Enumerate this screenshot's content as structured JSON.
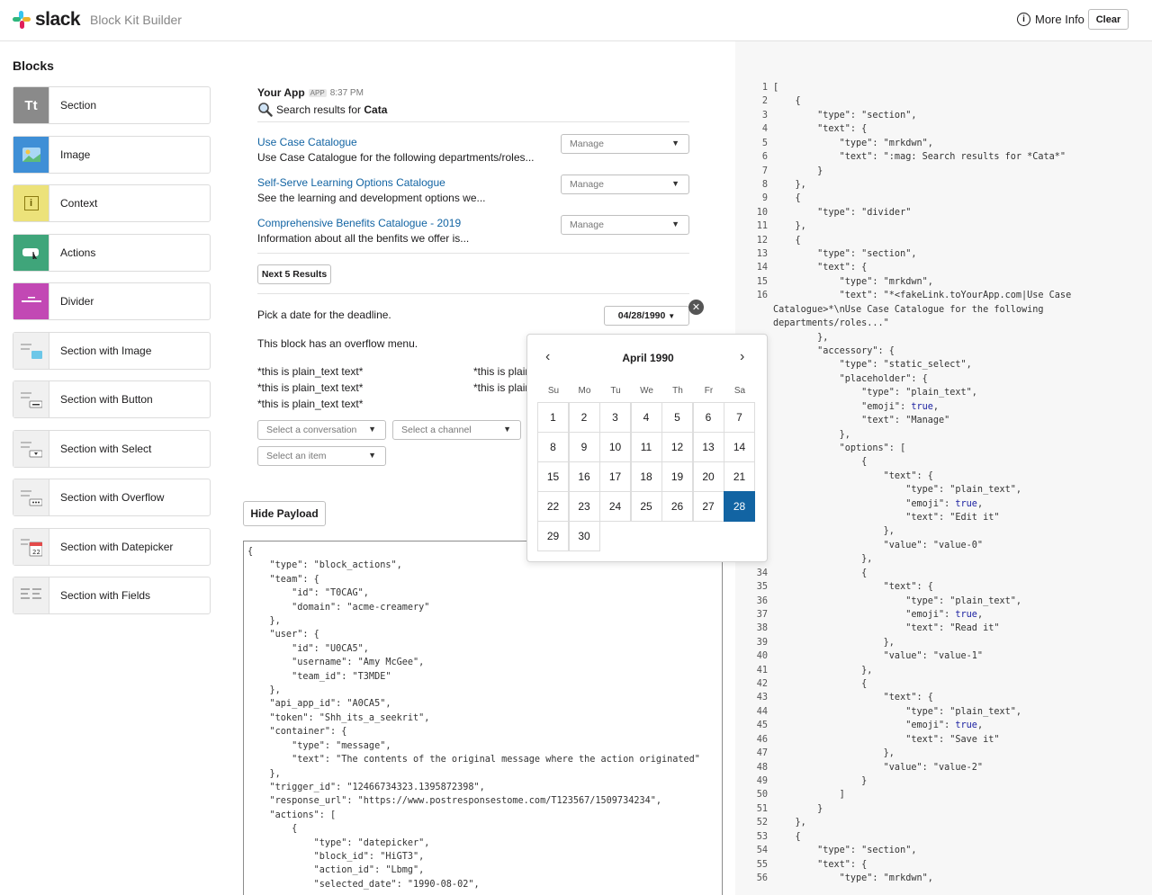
{
  "header": {
    "logo_text": "slack",
    "app_name": "Block Kit Builder",
    "more_info_label": "More Info",
    "clear_label": "Clear"
  },
  "sidebar": {
    "title": "Blocks",
    "items": [
      {
        "label": "Section",
        "icon": "section-icon",
        "color": "#8a8a8a"
      },
      {
        "label": "Image",
        "icon": "image-icon",
        "color": "#3f8fd6"
      },
      {
        "label": "Context",
        "icon": "context-icon",
        "color": "#ece27a"
      },
      {
        "label": "Actions",
        "icon": "actions-icon",
        "color": "#3fa57a"
      },
      {
        "label": "Divider",
        "icon": "divider-icon",
        "color": "#c248b4"
      },
      {
        "label": "Section with Image",
        "icon": "section-image-icon",
        "color": "#f0f0f0"
      },
      {
        "label": "Section with Button",
        "icon": "section-button-icon",
        "color": "#f0f0f0"
      },
      {
        "label": "Section with Select",
        "icon": "section-select-icon",
        "color": "#f0f0f0"
      },
      {
        "label": "Section with Overflow",
        "icon": "section-overflow-icon",
        "color": "#f0f0f0"
      },
      {
        "label": "Section with Datepicker",
        "icon": "section-datepicker-icon",
        "color": "#f0f0f0"
      },
      {
        "label": "Section with Fields",
        "icon": "section-fields-icon",
        "color": "#f0f0f0"
      }
    ]
  },
  "preview": {
    "app_name": "Your App",
    "app_badge": "APP",
    "time": "8:37 PM",
    "search_prefix": "Search results for ",
    "search_term": "Cata",
    "results": [
      {
        "title": "Use Case Catalogue",
        "desc": "Use Case Catalogue for the following departments/roles...",
        "select": "Manage"
      },
      {
        "title": "Self-Serve Learning Options Catalogue",
        "desc": "See the learning and development options we...",
        "select": "Manage"
      },
      {
        "title": "Comprehensive Benefits Catalogue - 2019",
        "desc": "Information about all the benfits we offer is...",
        "select": "Manage"
      }
    ],
    "next_button": "Next 5 Results",
    "deadline_text": "Pick a date for the deadline.",
    "date_value": "04/28/1990",
    "overflow_text": "This block has an overflow menu.",
    "fields_left": [
      "*this is plain_text text*",
      "*this is plain_text text*",
      "*this is plain_text text*"
    ],
    "fields_right": [
      "*this is plain_text text*",
      "*this is plain_text text*"
    ],
    "select_conversation": "Select a conversation",
    "select_channel": "Select a channel",
    "select_item": "Select an item"
  },
  "calendar": {
    "month_label": "April 1990",
    "weekdays": [
      "Su",
      "Mo",
      "Tu",
      "We",
      "Th",
      "Fr",
      "Sa"
    ],
    "days": [
      1,
      2,
      3,
      4,
      5,
      6,
      7,
      8,
      9,
      10,
      11,
      12,
      13,
      14,
      15,
      16,
      17,
      18,
      19,
      20,
      21,
      22,
      23,
      24,
      25,
      26,
      27,
      28,
      29,
      30
    ],
    "first_weekday": 0,
    "selected_day": 28
  },
  "payload": {
    "hide_label": "Hide Payload",
    "text": "{\n    \"type\": \"block_actions\",\n    \"team\": {\n        \"id\": \"T0CAG\",\n        \"domain\": \"acme-creamery\"\n    },\n    \"user\": {\n        \"id\": \"U0CA5\",\n        \"username\": \"Amy McGee\",\n        \"team_id\": \"T3MDE\"\n    },\n    \"api_app_id\": \"A0CA5\",\n    \"token\": \"Shh_its_a_seekrit\",\n    \"container\": {\n        \"type\": \"message\",\n        \"text\": \"The contents of the original message where the action originated\"\n    },\n    \"trigger_id\": \"12466734323.1395872398\",\n    \"response_url\": \"https://www.postresponsestome.com/T123567/1509734234\",\n    \"actions\": [\n        {\n            \"type\": \"datepicker\",\n            \"block_id\": \"HiGT3\",\n            \"action_id\": \"Lbmg\",\n            \"selected_date\": \"1990-08-02\","
  },
  "json_lines": [
    {
      "n": "1",
      "t": "["
    },
    {
      "n": "2",
      "t": "    {"
    },
    {
      "n": "3",
      "t": "        \"type\": \"section\","
    },
    {
      "n": "4",
      "t": "        \"text\": {"
    },
    {
      "n": "5",
      "t": "            \"type\": \"mrkdwn\","
    },
    {
      "n": "6",
      "t": "            \"text\": \":mag: Search results for *Cata*\""
    },
    {
      "n": "7",
      "t": "        }"
    },
    {
      "n": "8",
      "t": "    },"
    },
    {
      "n": "9",
      "t": "    {"
    },
    {
      "n": "10",
      "t": "        \"type\": \"divider\""
    },
    {
      "n": "11",
      "t": "    },"
    },
    {
      "n": "12",
      "t": "    {"
    },
    {
      "n": "13",
      "t": "        \"type\": \"section\","
    },
    {
      "n": "14",
      "t": "        \"text\": {"
    },
    {
      "n": "15",
      "t": "            \"type\": \"mrkdwn\","
    },
    {
      "n": "16",
      "t": "            \"text\": \"*<fakeLink.toYourApp.com|Use Case"
    },
    {
      "n": "",
      "t": "Catalogue>*\\nUse Case Catalogue for the following"
    },
    {
      "n": "",
      "t": "departments/roles...\""
    },
    {
      "n": "",
      "t": "        },"
    },
    {
      "n": "",
      "t": "        \"accessory\": {"
    },
    {
      "n": "",
      "t": "            \"type\": \"static_select\","
    },
    {
      "n": "",
      "t": "            \"placeholder\": {"
    },
    {
      "n": "",
      "t": "                \"type\": \"plain_text\","
    },
    {
      "n": "",
      "t": "                \"emoji\": true,"
    },
    {
      "n": "",
      "t": "                \"text\": \"Manage\""
    },
    {
      "n": "",
      "t": "            },"
    },
    {
      "n": "",
      "t": "            \"options\": ["
    },
    {
      "n": "",
      "t": "                {"
    },
    {
      "n": "",
      "t": "                    \"text\": {"
    },
    {
      "n": "",
      "t": "                        \"type\": \"plain_text\","
    },
    {
      "n": "",
      "t": "                        \"emoji\": true,"
    },
    {
      "n": "",
      "t": "                        \"text\": \"Edit it\""
    },
    {
      "n": "",
      "t": "                    },"
    },
    {
      "n": "",
      "t": "                    \"value\": \"value-0\""
    },
    {
      "n": "",
      "t": "                },"
    },
    {
      "n": "34",
      "t": "                {"
    },
    {
      "n": "35",
      "t": "                    \"text\": {"
    },
    {
      "n": "36",
      "t": "                        \"type\": \"plain_text\","
    },
    {
      "n": "37",
      "t": "                        \"emoji\": true,"
    },
    {
      "n": "38",
      "t": "                        \"text\": \"Read it\""
    },
    {
      "n": "39",
      "t": "                    },"
    },
    {
      "n": "40",
      "t": "                    \"value\": \"value-1\""
    },
    {
      "n": "41",
      "t": "                },"
    },
    {
      "n": "42",
      "t": "                {"
    },
    {
      "n": "43",
      "t": "                    \"text\": {"
    },
    {
      "n": "44",
      "t": "                        \"type\": \"plain_text\","
    },
    {
      "n": "45",
      "t": "                        \"emoji\": true,"
    },
    {
      "n": "46",
      "t": "                        \"text\": \"Save it\""
    },
    {
      "n": "47",
      "t": "                    },"
    },
    {
      "n": "48",
      "t": "                    \"value\": \"value-2\""
    },
    {
      "n": "49",
      "t": "                }"
    },
    {
      "n": "50",
      "t": "            ]"
    },
    {
      "n": "51",
      "t": "        }"
    },
    {
      "n": "52",
      "t": "    },"
    },
    {
      "n": "53",
      "t": "    {"
    },
    {
      "n": "54",
      "t": "        \"type\": \"section\","
    },
    {
      "n": "55",
      "t": "        \"text\": {"
    },
    {
      "n": "56",
      "t": "            \"type\": \"mrkdwn\","
    }
  ]
}
